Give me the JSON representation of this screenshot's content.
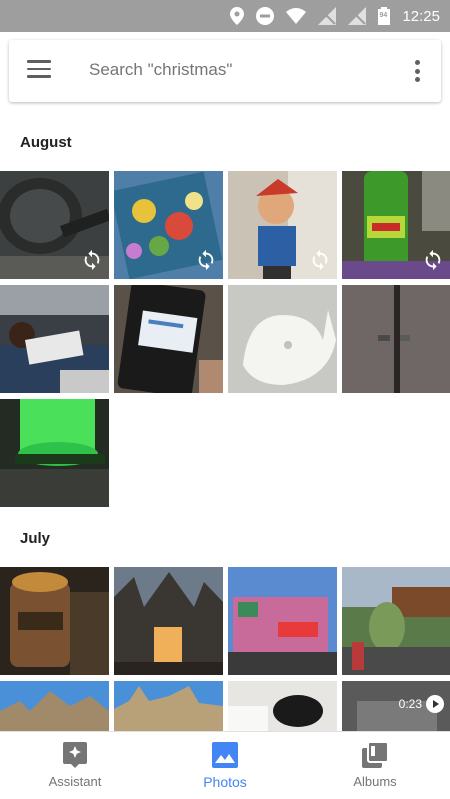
{
  "status_bar": {
    "time": "12:25",
    "battery": "94"
  },
  "search": {
    "placeholder": "Search \"christmas\""
  },
  "sections": [
    {
      "title": "August"
    },
    {
      "title": "July"
    }
  ],
  "video": {
    "duration": "0:23"
  },
  "bottom_nav": [
    {
      "label": "Assistant"
    },
    {
      "label": "Photos"
    },
    {
      "label": "Albums"
    }
  ],
  "colors": {
    "accent": "#4285f4",
    "status_bar": "#9e9e9e"
  }
}
